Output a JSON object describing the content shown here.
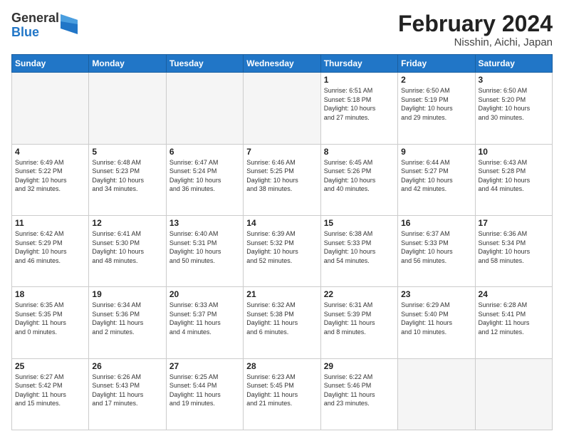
{
  "header": {
    "logo_line1": "General",
    "logo_line2": "Blue",
    "title": "February 2024",
    "subtitle": "Nisshin, Aichi, Japan"
  },
  "days_of_week": [
    "Sunday",
    "Monday",
    "Tuesday",
    "Wednesday",
    "Thursday",
    "Friday",
    "Saturday"
  ],
  "weeks": [
    [
      {
        "day": "",
        "info": "",
        "empty": true
      },
      {
        "day": "",
        "info": "",
        "empty": true
      },
      {
        "day": "",
        "info": "",
        "empty": true
      },
      {
        "day": "",
        "info": "",
        "empty": true
      },
      {
        "day": "1",
        "info": "Sunrise: 6:51 AM\nSunset: 5:18 PM\nDaylight: 10 hours\nand 27 minutes.",
        "empty": false
      },
      {
        "day": "2",
        "info": "Sunrise: 6:50 AM\nSunset: 5:19 PM\nDaylight: 10 hours\nand 29 minutes.",
        "empty": false
      },
      {
        "day": "3",
        "info": "Sunrise: 6:50 AM\nSunset: 5:20 PM\nDaylight: 10 hours\nand 30 minutes.",
        "empty": false
      }
    ],
    [
      {
        "day": "4",
        "info": "Sunrise: 6:49 AM\nSunset: 5:22 PM\nDaylight: 10 hours\nand 32 minutes.",
        "empty": false
      },
      {
        "day": "5",
        "info": "Sunrise: 6:48 AM\nSunset: 5:23 PM\nDaylight: 10 hours\nand 34 minutes.",
        "empty": false
      },
      {
        "day": "6",
        "info": "Sunrise: 6:47 AM\nSunset: 5:24 PM\nDaylight: 10 hours\nand 36 minutes.",
        "empty": false
      },
      {
        "day": "7",
        "info": "Sunrise: 6:46 AM\nSunset: 5:25 PM\nDaylight: 10 hours\nand 38 minutes.",
        "empty": false
      },
      {
        "day": "8",
        "info": "Sunrise: 6:45 AM\nSunset: 5:26 PM\nDaylight: 10 hours\nand 40 minutes.",
        "empty": false
      },
      {
        "day": "9",
        "info": "Sunrise: 6:44 AM\nSunset: 5:27 PM\nDaylight: 10 hours\nand 42 minutes.",
        "empty": false
      },
      {
        "day": "10",
        "info": "Sunrise: 6:43 AM\nSunset: 5:28 PM\nDaylight: 10 hours\nand 44 minutes.",
        "empty": false
      }
    ],
    [
      {
        "day": "11",
        "info": "Sunrise: 6:42 AM\nSunset: 5:29 PM\nDaylight: 10 hours\nand 46 minutes.",
        "empty": false
      },
      {
        "day": "12",
        "info": "Sunrise: 6:41 AM\nSunset: 5:30 PM\nDaylight: 10 hours\nand 48 minutes.",
        "empty": false
      },
      {
        "day": "13",
        "info": "Sunrise: 6:40 AM\nSunset: 5:31 PM\nDaylight: 10 hours\nand 50 minutes.",
        "empty": false
      },
      {
        "day": "14",
        "info": "Sunrise: 6:39 AM\nSunset: 5:32 PM\nDaylight: 10 hours\nand 52 minutes.",
        "empty": false
      },
      {
        "day": "15",
        "info": "Sunrise: 6:38 AM\nSunset: 5:33 PM\nDaylight: 10 hours\nand 54 minutes.",
        "empty": false
      },
      {
        "day": "16",
        "info": "Sunrise: 6:37 AM\nSunset: 5:33 PM\nDaylight: 10 hours\nand 56 minutes.",
        "empty": false
      },
      {
        "day": "17",
        "info": "Sunrise: 6:36 AM\nSunset: 5:34 PM\nDaylight: 10 hours\nand 58 minutes.",
        "empty": false
      }
    ],
    [
      {
        "day": "18",
        "info": "Sunrise: 6:35 AM\nSunset: 5:35 PM\nDaylight: 11 hours\nand 0 minutes.",
        "empty": false
      },
      {
        "day": "19",
        "info": "Sunrise: 6:34 AM\nSunset: 5:36 PM\nDaylight: 11 hours\nand 2 minutes.",
        "empty": false
      },
      {
        "day": "20",
        "info": "Sunrise: 6:33 AM\nSunset: 5:37 PM\nDaylight: 11 hours\nand 4 minutes.",
        "empty": false
      },
      {
        "day": "21",
        "info": "Sunrise: 6:32 AM\nSunset: 5:38 PM\nDaylight: 11 hours\nand 6 minutes.",
        "empty": false
      },
      {
        "day": "22",
        "info": "Sunrise: 6:31 AM\nSunset: 5:39 PM\nDaylight: 11 hours\nand 8 minutes.",
        "empty": false
      },
      {
        "day": "23",
        "info": "Sunrise: 6:29 AM\nSunset: 5:40 PM\nDaylight: 11 hours\nand 10 minutes.",
        "empty": false
      },
      {
        "day": "24",
        "info": "Sunrise: 6:28 AM\nSunset: 5:41 PM\nDaylight: 11 hours\nand 12 minutes.",
        "empty": false
      }
    ],
    [
      {
        "day": "25",
        "info": "Sunrise: 6:27 AM\nSunset: 5:42 PM\nDaylight: 11 hours\nand 15 minutes.",
        "empty": false
      },
      {
        "day": "26",
        "info": "Sunrise: 6:26 AM\nSunset: 5:43 PM\nDaylight: 11 hours\nand 17 minutes.",
        "empty": false
      },
      {
        "day": "27",
        "info": "Sunrise: 6:25 AM\nSunset: 5:44 PM\nDaylight: 11 hours\nand 19 minutes.",
        "empty": false
      },
      {
        "day": "28",
        "info": "Sunrise: 6:23 AM\nSunset: 5:45 PM\nDaylight: 11 hours\nand 21 minutes.",
        "empty": false
      },
      {
        "day": "29",
        "info": "Sunrise: 6:22 AM\nSunset: 5:46 PM\nDaylight: 11 hours\nand 23 minutes.",
        "empty": false
      },
      {
        "day": "",
        "info": "",
        "empty": true
      },
      {
        "day": "",
        "info": "",
        "empty": true
      }
    ]
  ]
}
